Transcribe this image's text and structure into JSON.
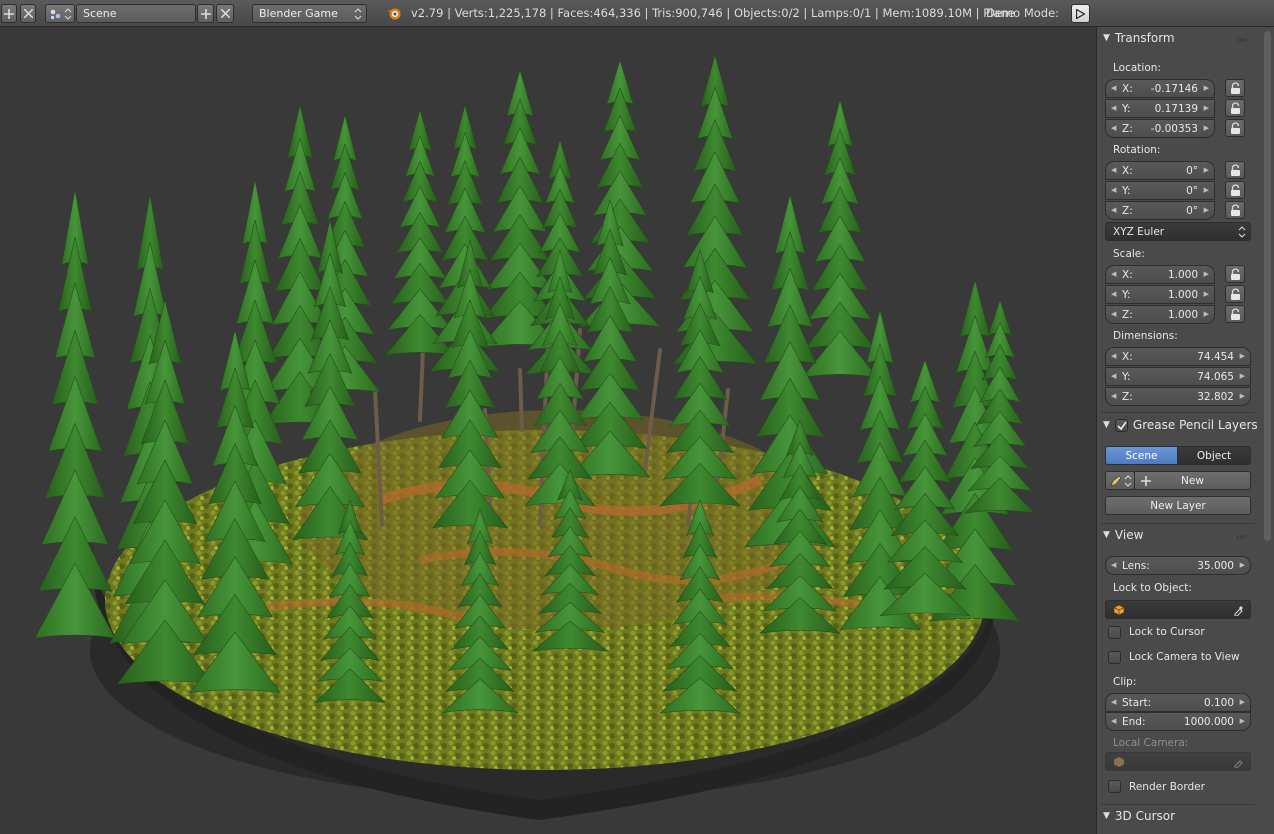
{
  "header": {
    "scene_name": "Scene",
    "engine": "Blender Game",
    "info": "v2.79 | Verts:1,225,178 | Faces:464,336 | Tris:900,746 | Objects:0/2 | Lamps:0/1 | Mem:1089.10M | Plane",
    "demo_mode_label": "Demo Mode:"
  },
  "transform": {
    "title": "Transform",
    "location_label": "Location:",
    "location": [
      {
        "k": "X:",
        "v": "-0.17146"
      },
      {
        "k": "Y:",
        "v": "0.17139"
      },
      {
        "k": "Z:",
        "v": "-0.00353"
      }
    ],
    "rotation_label": "Rotation:",
    "rotation": [
      {
        "k": "X:",
        "v": "0°"
      },
      {
        "k": "Y:",
        "v": "0°"
      },
      {
        "k": "Z:",
        "v": "0°"
      }
    ],
    "rotation_mode": "XYZ Euler",
    "scale_label": "Scale:",
    "scale": [
      {
        "k": "X:",
        "v": "1.000"
      },
      {
        "k": "Y:",
        "v": "1.000"
      },
      {
        "k": "Z:",
        "v": "1.000"
      }
    ],
    "dimensions_label": "Dimensions:",
    "dimensions": [
      {
        "k": "X:",
        "v": "74.454"
      },
      {
        "k": "Y:",
        "v": "74.065"
      },
      {
        "k": "Z:",
        "v": "32.802"
      }
    ]
  },
  "grease_pencil": {
    "title": "Grease Pencil Layers",
    "tab_scene": "Scene",
    "tab_object": "Object",
    "new_label": "New",
    "new_layer_label": "New Layer"
  },
  "view": {
    "title": "View",
    "lens_label": "Lens:",
    "lens_value": "35.000",
    "lock_object_label": "Lock to Object:",
    "lock_cursor_label": "Lock to Cursor",
    "lock_camera_label": "Lock Camera to View",
    "clip_label": "Clip:",
    "clip_start_label": "Start:",
    "clip_start_value": "0.100",
    "clip_end_label": "End:",
    "clip_end_value": "1000.000",
    "local_camera_label": "Local Camera:",
    "render_border_label": "Render Border"
  },
  "cursor_panel": {
    "title": "3D Cursor"
  },
  "colors": {
    "active_tab": "#5680c2",
    "foliage": "#3f8a2e",
    "ground_orange": "#b86a2c",
    "panel_bg": "#4a4a4a"
  }
}
